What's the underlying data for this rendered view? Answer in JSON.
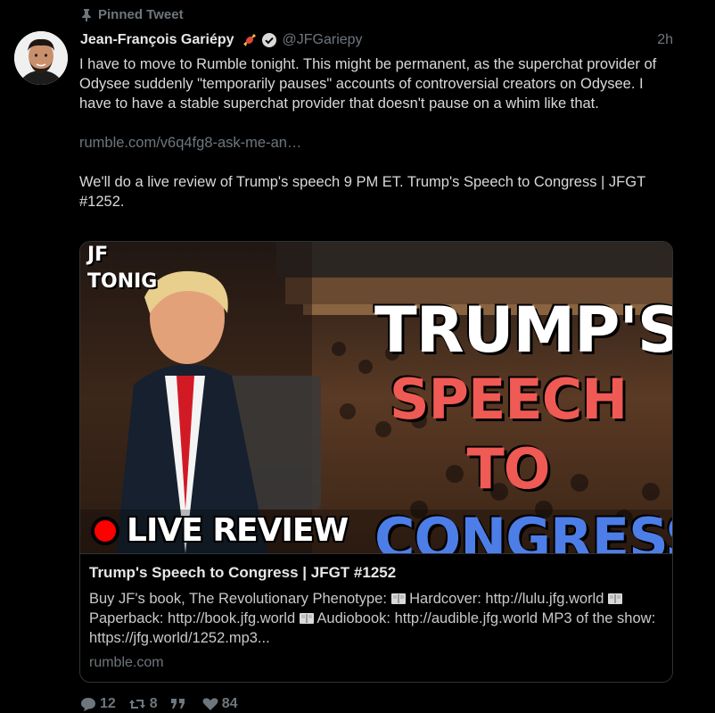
{
  "pinned_label": "Pinned Tweet",
  "author": {
    "name": "Jean-François Gariépy",
    "handle": "@JFGariepy",
    "time": "2h"
  },
  "body": {
    "paragraph1": "I have to move to Rumble tonight. This might be permanent, as the superchat provider of Odysee suddenly \"temporarily pauses\" accounts of controversial creators on Odysee. I have to have a stable superchat provider that doesn't pause on a whim like that.",
    "link": "rumble.com/v6q4fg8-ask-me-an…",
    "paragraph2": "We'll do a live review of Trump's speech 9 PM ET. Trump's Speech to Congress | JFGT #1252."
  },
  "card": {
    "image_text": {
      "corner_line1": "JF",
      "corner_line2": "TONIG",
      "line1": "TRUMP'S",
      "line2": "SPEECH TO",
      "line3": "CONGRESS",
      "live": "LIVE REVIEW"
    },
    "title": "Trump's Speech to Congress | JFGT #1252",
    "desc_part1": "Buy JF's book, The Revolutionary Phenotype:",
    "desc_part2": "Hardcover: http://lulu.jfg.world",
    "desc_part3": "Paperback: http://book.jfg.world",
    "desc_part4": "Audiobook: http://audible.jfg.world MP3 of the show: https://jfg.world/1252.mp3...",
    "domain": "rumble.com"
  },
  "actions": {
    "replies": "12",
    "retweets": "8",
    "quotes": "",
    "likes": "84"
  },
  "icons": {
    "pin": "pin-icon",
    "emoji": "candy-icon",
    "verified": "verified-check-icon",
    "reply": "reply-bubble-icon",
    "retweet": "retweet-icon",
    "quote": "quote-icon",
    "like": "heart-icon",
    "book": "book-icon"
  },
  "colors": {
    "background": "#000000",
    "muted": "#6e767d",
    "text": "#d9d9d9",
    "red_title": "#ef5a54",
    "blue_title": "#4d7ee8",
    "live_dot": "#ff0000"
  }
}
